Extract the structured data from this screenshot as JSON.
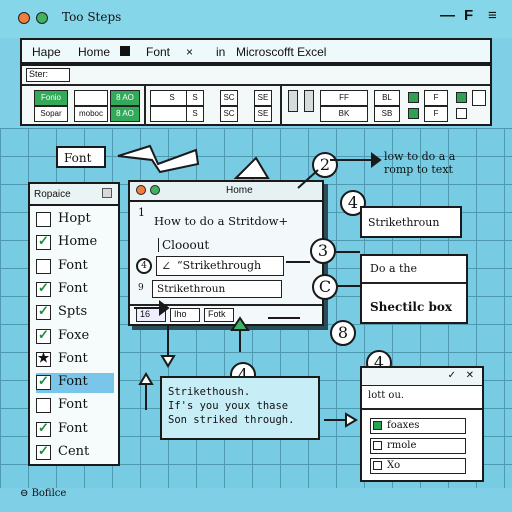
{
  "window": {
    "title": "Too Steps",
    "controls": [
      "—",
      "F",
      "≡"
    ]
  },
  "menu": {
    "items": [
      "Hape",
      "Home",
      "Font",
      "×",
      "in",
      "Microscofft Excel"
    ]
  },
  "ribbon": {
    "style_label": "Ster:",
    "btn_fonio": "Fonio",
    "btn_sopar": "Sopar",
    "btn_8a": "8 AO",
    "btn_mobec": "moboc",
    "btn_8b": "8 AO",
    "btn_s1": "S",
    "btn_s2": "S",
    "btn_s3": "S",
    "btn_sc": "SC",
    "btn_se": "SE",
    "btn_ff": "FF",
    "btn_bl": "BL",
    "btn_bk": "BK",
    "btn_sb": "SB",
    "btn_f1": "F",
    "btn_f2": "F"
  },
  "left_pane": {
    "header": "Ropaice",
    "items": [
      {
        "label": "Hopt",
        "check": "",
        "selected": false
      },
      {
        "label": "Home",
        "check": "✓",
        "selected": false
      },
      {
        "label": "Font",
        "check": "",
        "selected": false
      },
      {
        "label": "Font",
        "check": "✓",
        "selected": false
      },
      {
        "label": "Spts",
        "check": "✓",
        "selected": false
      },
      {
        "label": "Foxe",
        "check": "✓",
        "selected": false
      },
      {
        "label": "Font",
        "check": "★",
        "selected": false
      },
      {
        "label": "Font",
        "check": "✓",
        "selected": true
      },
      {
        "label": "Font",
        "check": "",
        "selected": false
      },
      {
        "label": "Font",
        "check": "✓",
        "selected": false
      },
      {
        "label": "Cent",
        "check": "✓",
        "selected": false
      }
    ]
  },
  "callouts": {
    "font": "Font",
    "how_to_l1": "low to do a a",
    "how_to_l2": "romp to text",
    "strikethrough_box": "Strikethroun",
    "do_a_the": "Do a the",
    "shectilc_box": "Shectilc box",
    "num_2": "2",
    "num_4a": "4",
    "num_3": "3",
    "num_c": "C",
    "num_8": "8",
    "num_4b": "4",
    "num_4c": "4"
  },
  "dialog": {
    "title": "Home",
    "step1": "1",
    "heading": "How to do a Stritdow+",
    "clooout": "Clooout",
    "step4": "4",
    "field_value": "“Strikethrough",
    "step9": "9",
    "strikethroun": "Strikethroun",
    "tab1": "16",
    "tab2": "Iho",
    "tab3": "Fotk"
  },
  "tooltip": {
    "line1": "Strikethoush.",
    "line2": "If's you youx thase",
    "line3": "Son striked through."
  },
  "right_small": {
    "title": "lott ou.",
    "rows": [
      "foaxes",
      "rmole",
      "Xo"
    ]
  },
  "status": {
    "text": "Bofilce"
  }
}
